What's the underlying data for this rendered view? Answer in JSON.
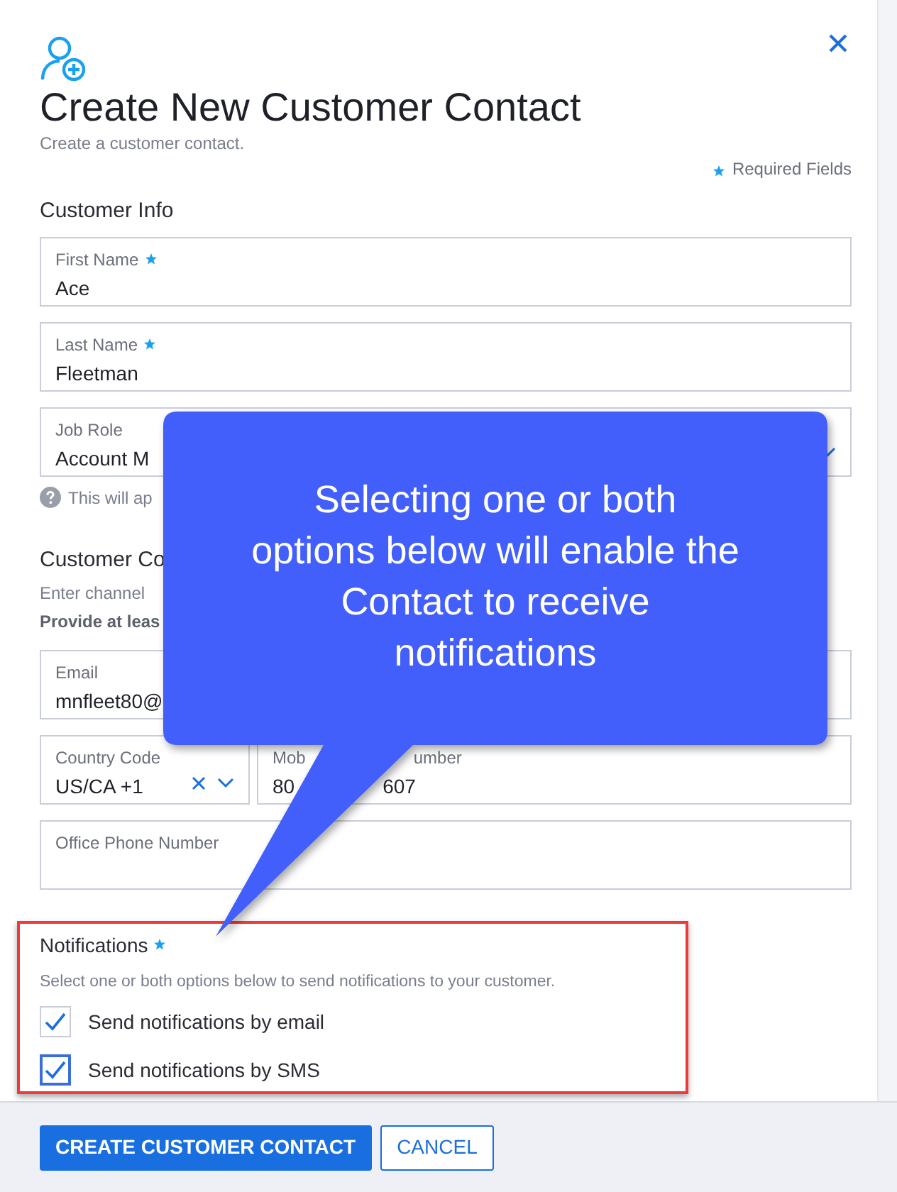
{
  "header": {
    "title": "Create New Customer Contact",
    "subtitle": "Create a customer contact.",
    "required_note": "Required Fields"
  },
  "customer_info": {
    "heading": "Customer Info",
    "fields": [
      {
        "label": "First Name",
        "required": true,
        "value": "Ace"
      },
      {
        "label": "Last Name",
        "required": true,
        "value": "Fleetman"
      },
      {
        "label": "Job Role",
        "required": false,
        "value": "Account M"
      }
    ],
    "help_text": "This will ap"
  },
  "customer_contact": {
    "heading": "Customer Co",
    "hint": "Enter channel",
    "hint_bold": "Provide at leas",
    "email": {
      "label": "Email",
      "value": "mnfleet80@"
    },
    "country_code": {
      "label": "Country Code",
      "value": "US/CA +1"
    },
    "mobile": {
      "label_parts": [
        "Mob",
        "umber"
      ],
      "value_parts": [
        "80",
        "607"
      ]
    },
    "office_phone": {
      "label": "Office Phone Number"
    }
  },
  "notifications": {
    "heading": "Notifications",
    "required": true,
    "hint": "Select one or both options below to send notifications to your customer.",
    "options": [
      {
        "label": "Send notifications by email",
        "checked": true
      },
      {
        "label": "Send notifications by SMS",
        "checked": true
      }
    ]
  },
  "callout": {
    "lines": [
      "Selecting one or both",
      "options below will enable the",
      "Contact to receive",
      "notifications"
    ]
  },
  "footer": {
    "buttons": [
      {
        "label": "CREATE CUSTOMER CONTACT",
        "kind": "primary"
      },
      {
        "label": "CANCEL",
        "kind": "secondary"
      }
    ]
  }
}
